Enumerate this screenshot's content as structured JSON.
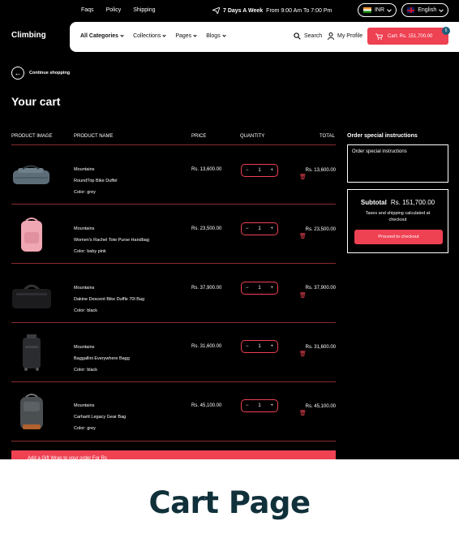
{
  "topbar": {
    "links": [
      "Faqs",
      "Policy",
      "Shipping"
    ],
    "promo_bold": "7 Days A Week",
    "promo_text": "From 9:00 Am To 7:00 Pm",
    "currency": "INR",
    "language": "English"
  },
  "header": {
    "logo": "Climbing",
    "nav": [
      "All Categories",
      "Collections",
      "Pages",
      "Blogs"
    ],
    "search_label": "Search",
    "profile_label": "My Profile",
    "cart_label": "Cart: Rs. 151,700.00",
    "cart_count": "5"
  },
  "page": {
    "continue_label": "Continue shopping",
    "title": "Your cart"
  },
  "table": {
    "headers": [
      "PRODUCT IMAGE",
      "PRODUCT NAME",
      "PRICE",
      "QUANTITY",
      "TOTAL"
    ],
    "rows": [
      {
        "brand": "Mountains",
        "name": "RoundTrip Bike Duffel",
        "color": "Color: grey",
        "price": "Rs. 13,600.00",
        "qty": "1",
        "total": "Rs. 13,600.00"
      },
      {
        "brand": "Mountains",
        "name": "Women's Rachel Tote Purse Handbag",
        "color": "Color: baby pink",
        "price": "Rs. 23,500.00",
        "qty": "1",
        "total": "Rs. 23,500.00"
      },
      {
        "brand": "Mountains",
        "name": "Dakine Descent Bike Duffle 70l Bag",
        "color": "Color: black",
        "price": "Rs. 37,900.00",
        "qty": "1",
        "total": "Rs. 37,900.00"
      },
      {
        "brand": "Mountains",
        "name": "Baggallini Everywhere Bagg",
        "color": "Color: black",
        "price": "Rs. 31,600.00",
        "qty": "1",
        "total": "Rs. 31,600.00"
      },
      {
        "brand": "Mountains",
        "name": "Carhartt Legacy Gear Bag",
        "color": "Color: grey",
        "price": "Rs. 45,100.00",
        "qty": "1",
        "total": "Rs. 45,100.00"
      }
    ]
  },
  "sidebar": {
    "note_title": "Order special instructions",
    "note_placeholder": "Order special instructions",
    "subtotal_label": "Subtotal",
    "subtotal_value": "Rs. 151,700.00",
    "tax_note": "Taxes and shipping calculated at checkout",
    "checkout_label": "Proceed to checkout"
  },
  "gift_bar": "Add a Gift Wrap to your order For Rs",
  "caption": "Cart Page",
  "colors": {
    "accent": "#ee4152",
    "background": "#000000",
    "caption": "#10303a"
  }
}
